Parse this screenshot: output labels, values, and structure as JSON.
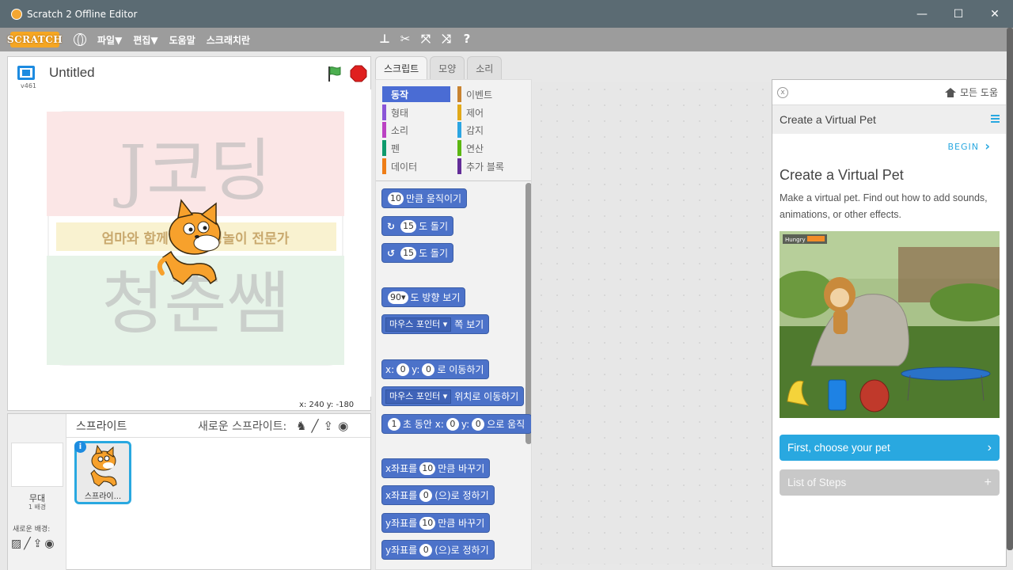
{
  "window": {
    "title": "Scratch 2 Offline Editor",
    "minimize": "—",
    "maximize": "☐",
    "close": "✕"
  },
  "menubar": {
    "logo": "SCRATCH",
    "file": "파일▼",
    "edit": "편집▼",
    "help": "도움말",
    "tutorial": "스크래치란"
  },
  "stage": {
    "version": "v461",
    "project_title": "Untitled",
    "coords": "x: 240  y: -180"
  },
  "watermark": {
    "top": "J코딩",
    "middle": "엄마와 함께하는 코딩놀이 전문가",
    "bottom": "청춘쌤"
  },
  "sprites": {
    "header": "스프라이트",
    "new_sprite": "새로운 스프라이트:",
    "stage_name": "무대",
    "stage_sub": "1 배경",
    "new_backdrop": "새로운 배경:",
    "sprite1_name": "스프라이...",
    "info": "i"
  },
  "tabs": {
    "scripts": "스크립트",
    "costumes": "모양",
    "sounds": "소리"
  },
  "categories": [
    {
      "label": "동작",
      "color": "#4a6cd4"
    },
    {
      "label": "형태",
      "color": "#8a55d7"
    },
    {
      "label": "소리",
      "color": "#bb42c3"
    },
    {
      "label": "펜",
      "color": "#0e9a6c"
    },
    {
      "label": "데이터",
      "color": "#ee7d16"
    },
    {
      "label": "이벤트",
      "color": "#c88330"
    },
    {
      "label": "제어",
      "color": "#e1a91a"
    },
    {
      "label": "감지",
      "color": "#2ca5e2"
    },
    {
      "label": "연산",
      "color": "#5cb712"
    },
    {
      "label": "추가 블록",
      "color": "#632d99"
    }
  ],
  "blocks": {
    "move": {
      "num": "10",
      "text": "만큼 움직이기"
    },
    "turn_right": {
      "icon": "↻",
      "num": "15",
      "text": "도 돌기"
    },
    "turn_left": {
      "icon": "↺",
      "num": "15",
      "text": "도 돌기"
    },
    "point_dir": {
      "num": "90▾",
      "text": "도 방향 보기"
    },
    "point_towards": {
      "dd": "마우스 포인터 ▾",
      "text": "쪽 보기"
    },
    "goto_xy": {
      "x": "x:",
      "xv": "0",
      "y": "y:",
      "yv": "0",
      "text": "로 이동하기"
    },
    "goto": {
      "dd": "마우스 포인터 ▾",
      "text": "위치로 이동하기"
    },
    "glide": {
      "num": "1",
      "t1": "초 동안 x:",
      "xv": "0",
      "t2": "y:",
      "yv": "0",
      "t3": "으로 움직"
    },
    "change_x": {
      "t1": "x좌표를",
      "num": "10",
      "t2": "만큼 바꾸기"
    },
    "set_x": {
      "t1": "x좌표를",
      "num": "0",
      "t2": "(으)로 정하기"
    },
    "change_y": {
      "t1": "y좌표를",
      "num": "10",
      "t2": "만큼 바꾸기"
    },
    "set_y": {
      "t1": "y좌표를",
      "num": "0",
      "t2": "(으)로 정하기"
    }
  },
  "help": {
    "all_help": "모든 도움",
    "close": "x",
    "title_bar": "Create a Virtual Pet",
    "begin": "BEGIN",
    "heading": "Create a Virtual Pet",
    "description": "Make a virtual pet. Find out how to add sounds, animations, or other effects.",
    "image_label": "Hungry",
    "first_step": "First, choose your pet",
    "list_steps": "List of Steps"
  }
}
